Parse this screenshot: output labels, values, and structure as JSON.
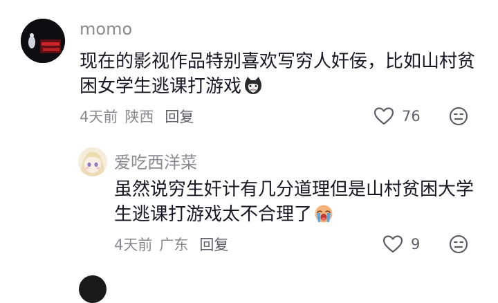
{
  "comments": [
    {
      "username": "momo",
      "text": "现在的影视作品特别喜欢写穷人奸佞，比如山村贫困女学生逃课打游戏",
      "emoji": "cat-emoji",
      "time": "4天前",
      "location": "陕西",
      "reply_label": "回复",
      "likes": "76"
    },
    {
      "username": "爱吃西洋菜",
      "text": "虽然说穷生奸计有几分道理但是山村贫困大学生逃课打游戏太不合理了",
      "emoji": "crying-face-emoji",
      "time": "4天前",
      "location": "广东",
      "reply_label": "回复",
      "likes": "9"
    }
  ],
  "colors": {
    "text": "#161823",
    "meta": "#8a8b91",
    "background": "#ffffff"
  }
}
